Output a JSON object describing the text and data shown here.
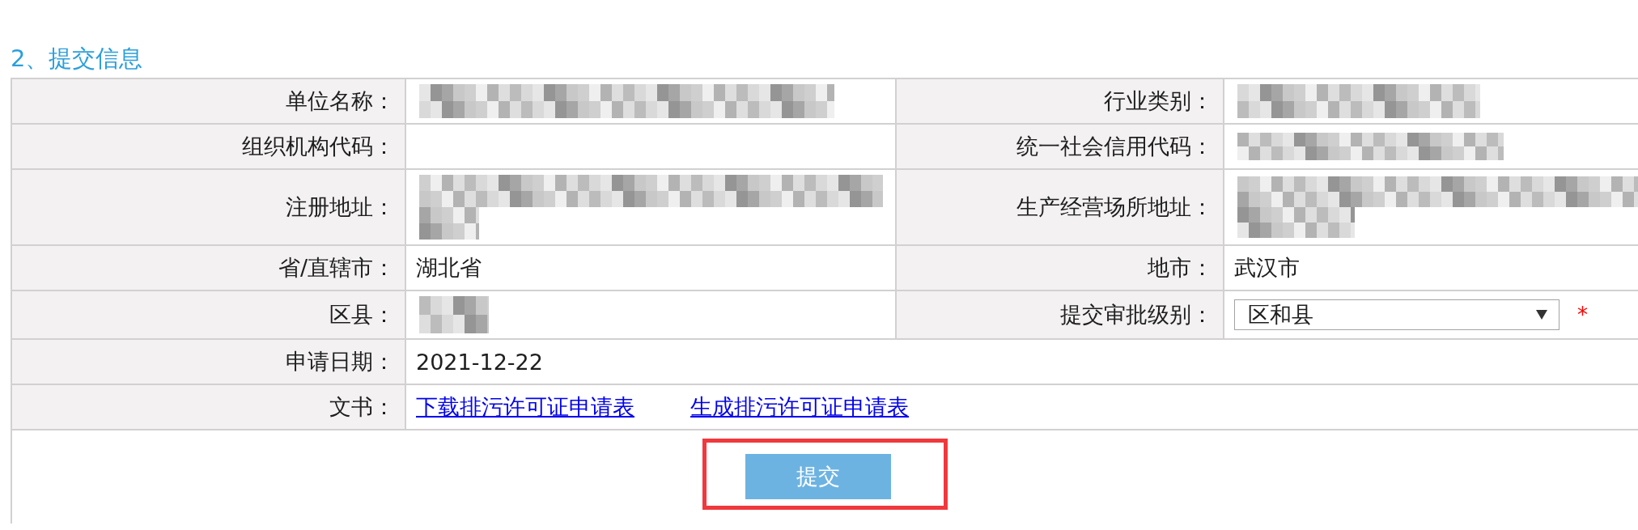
{
  "section": {
    "title": "2、提交信息"
  },
  "rows": [
    {
      "cells": [
        {
          "label": "单位名称：",
          "kind": "text",
          "redacted": true
        },
        {
          "label": "行业类别：",
          "kind": "text",
          "redacted": true
        }
      ]
    },
    {
      "cells": [
        {
          "label": "组织机构代码：",
          "kind": "text",
          "redacted": false
        },
        {
          "label": "统一社会信用代码：",
          "kind": "text",
          "redacted": true
        }
      ]
    },
    {
      "cells": [
        {
          "label": "注册地址：",
          "kind": "text",
          "redacted": true
        },
        {
          "label": "生产经营场所地址：",
          "kind": "text",
          "redacted": true
        }
      ]
    },
    {
      "cells": [
        {
          "label": "省/直辖市：",
          "kind": "text",
          "redacted": false,
          "value": "湖北省"
        },
        {
          "label": "地市：",
          "kind": "text",
          "redacted": false,
          "value": "武汉市"
        }
      ]
    },
    {
      "cells": [
        {
          "label": "区县：",
          "kind": "text",
          "redacted": true
        },
        {
          "label": "提交审批级别：",
          "kind": "select",
          "redacted": false,
          "value": "区和县",
          "required_mark": "*"
        }
      ]
    },
    {
      "cells": [
        {
          "label": "申请日期：",
          "kind": "text",
          "redacted": false,
          "value": "2021-12-22"
        }
      ]
    },
    {
      "cells": [
        {
          "label": "文书：",
          "kind": "links",
          "redacted": false,
          "links": [
            {
              "label": "下载排污许可证申请表"
            },
            {
              "label": "生成排污许可证申请表"
            }
          ]
        }
      ]
    }
  ],
  "submit_button": {
    "label": "提交",
    "highlighted": true
  }
}
